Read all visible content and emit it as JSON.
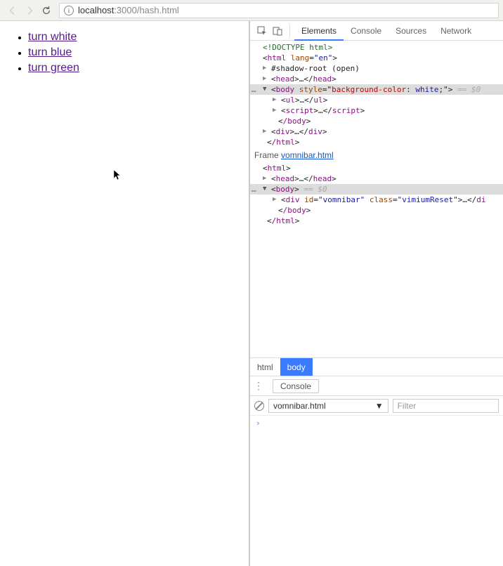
{
  "address": {
    "host": "localhost",
    "port_path": ":3000/hash.html"
  },
  "links": {
    "white": "turn white",
    "blue": "turn blue",
    "green": "turn green"
  },
  "devtools_tabs": {
    "elements": "Elements",
    "console": "Console",
    "sources": "Sources",
    "network": "Network"
  },
  "dom": {
    "doctype": "<!DOCTYPE html>",
    "html_tag": "html",
    "lang_attr": "lang",
    "lang_val": "\"en\"",
    "shadow": "#shadow-root (open)",
    "head_open": "head",
    "head_dots": "…",
    "body_tag": "body",
    "style_attr": "style",
    "style_val": "\"background-color: white;\"",
    "eq0": " == $0",
    "ul_tag": "ul",
    "script_tag": "script",
    "div_tag": "div",
    "close_body": "/body",
    "close_html": "/html",
    "frame_label": "Frame ",
    "frame_link": "vomnibar.html",
    "head2": "head",
    "id_attr": "id",
    "vomnibar_val": "\"vomnibar\"",
    "class_attr": "class",
    "vimium_val": "\"vimiumReset\"",
    "di_trail": "di"
  },
  "breadcrumb": {
    "html": "html",
    "body": "body"
  },
  "console": {
    "title": "Console",
    "context": "vomnibar.html",
    "filter_placeholder": "Filter",
    "prompt": "›"
  }
}
